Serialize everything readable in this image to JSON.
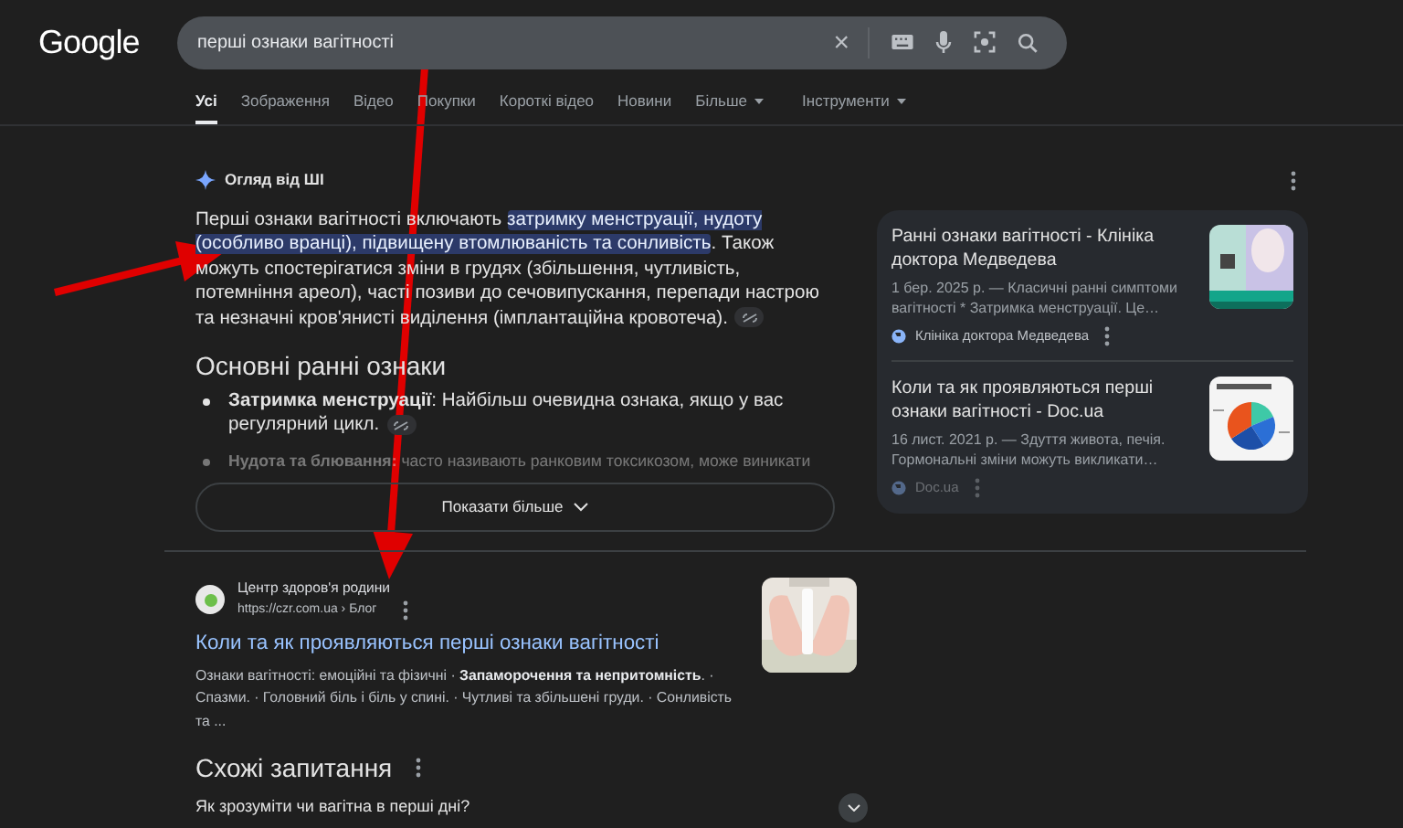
{
  "header": {
    "logo": "Google",
    "search": {
      "value": "перші ознаки вагітності",
      "clear": "×"
    },
    "tabs": [
      {
        "label": "Усі",
        "selected": true,
        "kind": "plain"
      },
      {
        "label": "Зображення",
        "selected": false,
        "kind": "plain"
      },
      {
        "label": "Відео",
        "selected": false,
        "kind": "plain"
      },
      {
        "label": "Покупки",
        "selected": false,
        "kind": "plain"
      },
      {
        "label": "Короткі відео",
        "selected": false,
        "kind": "plain"
      },
      {
        "label": "Новини",
        "selected": false,
        "kind": "plain"
      },
      {
        "label": "Більше",
        "selected": false,
        "kind": "dropdown"
      },
      {
        "label": "Інструменти",
        "selected": false,
        "kind": "dropdown"
      }
    ]
  },
  "ai_overview": {
    "label": "Огляд від ШІ",
    "paragraph": [
      {
        "text": "Перші ознаки вагітності включають ",
        "highlighted": false
      },
      {
        "text": "затримку менструації, нудоту (особливо вранці), підвищену втомлюваність та сонливість",
        "highlighted": true
      },
      {
        "text": ". Також можуть спостерігатися зміни в грудях (збільшення, чутливість, потемніння ареол), часті позиви до сечовипускання, перепади настрою та незначні кров'янисті виділення (імплантаційна кровотеча).",
        "highlighted": false
      }
    ],
    "heading": "Основні ранні ознаки",
    "bullets": [
      {
        "text": "**Затримка менструації**: Найбільш очевидна ознака, якщо у вас регулярний цикл.",
        "faded": false,
        "link": true
      },
      {
        "text": "**Нудота та блювання:** часто називають ранковим токсикозом, може виникати",
        "faded": true,
        "link": false
      }
    ],
    "show_more": "Показати більше",
    "sources": [
      {
        "title": "Ранні ознаки вагітності - Клініка доктора Медведева",
        "snippet": "1 бер. 2025 р. — Класичні ранні симптоми вагітності * Затримка менструації. Це…",
        "site": "Клініка доктора Медведева",
        "faded": false
      },
      {
        "title": "Коли та як проявляються перші ознаки вагітності - Doc.ua",
        "snippet": "16 лист. 2021 р. — Здуття живота, печія. Гормональні зміни можуть викликати…",
        "site": "Doc.ua",
        "faded": true
      }
    ]
  },
  "result": {
    "site": "Центр здоров'я родини",
    "url": "https://czr.com.ua › Блог",
    "title": "Коли та як проявляються перші ознаки вагітності",
    "snippet": "Ознаки вагітності: емоційні та фізичні · **Запаморочення та непритомність**. · Спазми. · Головний біль і біль у спині. · Чутливі та збільшені груди. · Сонливість та ..."
  },
  "related": {
    "heading": "Схожі запитання",
    "questions": [
      "Як зрозуміти чи вагітна в перші дні?"
    ]
  }
}
